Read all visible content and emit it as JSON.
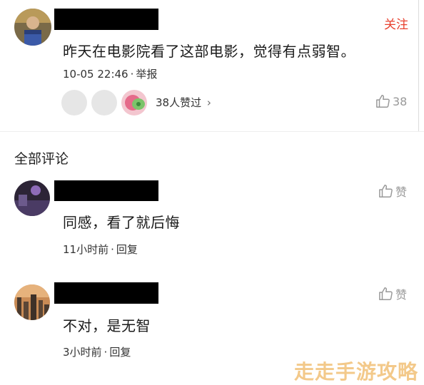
{
  "post": {
    "follow_label": "关注",
    "text": "昨天在电影院看了这部电影，觉得有点弱智。",
    "time": "10-05 22:46",
    "report_label": "举报",
    "likers_text": "38人赞过",
    "likers_chevron": "›",
    "like_count": "38"
  },
  "section_title": "全部评论",
  "comments": [
    {
      "text": "同感，看了就后悔",
      "time": "11小时前",
      "reply_label": "回复",
      "like_label": "赞"
    },
    {
      "text": "不对，是无智",
      "time": "3小时前",
      "reply_label": "回复",
      "like_label": "赞"
    }
  ],
  "watermark": "走走手游攻略",
  "icons": {
    "thumb": "thumbs-up-icon",
    "chevron": "chevron-right-icon"
  },
  "colors": {
    "follow": "#e8412f",
    "muted": "#999999",
    "watermark": "#f3c98a"
  }
}
